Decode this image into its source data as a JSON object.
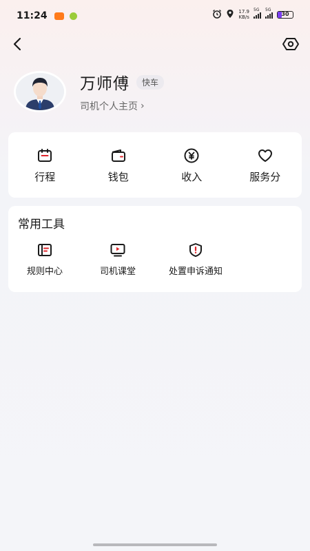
{
  "status_bar": {
    "time": "11:24",
    "net_speed_value": "17.9",
    "net_speed_unit": "KB/s",
    "signal1": "5G",
    "signal2": "5G",
    "battery": "30"
  },
  "nav": {
    "back_icon": "chevron-left-icon",
    "view_icon": "eye-icon"
  },
  "profile": {
    "name": "万师傅",
    "badge": "快车",
    "homepage_link": "司机个人主页",
    "link_chevron": "›"
  },
  "quick_actions": [
    {
      "label": "行程",
      "icon": "calendar-icon"
    },
    {
      "label": "钱包",
      "icon": "wallet-icon"
    },
    {
      "label": "收入",
      "icon": "yen-coin-icon"
    },
    {
      "label": "服务分",
      "icon": "heart-icon"
    }
  ],
  "tools": {
    "title": "常用工具",
    "items": [
      {
        "label": "规则中心",
        "icon": "rulebook-icon"
      },
      {
        "label": "司机课堂",
        "icon": "video-play-icon"
      },
      {
        "label": "处置申诉通知",
        "icon": "shield-alert-icon"
      }
    ]
  },
  "colors": {
    "accent_red": "#e0252b",
    "background": "#f4f5f9",
    "card": "#ffffff"
  }
}
